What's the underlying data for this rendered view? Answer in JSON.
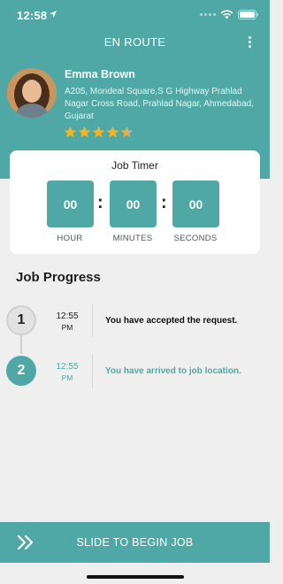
{
  "status_bar": {
    "time": "12:58"
  },
  "nav": {
    "title": "EN ROUTE"
  },
  "customer": {
    "name": "Emma Brown",
    "address": "A205, Mondeal Square,S G Highway Prahlad Nagar Cross Road, Prahlad Nagar, Ahmedabad, Gujarat",
    "rating": 4.5,
    "rating_max": 5
  },
  "timer": {
    "title": "Job Timer",
    "hour": "00",
    "minutes": "00",
    "seconds": "00",
    "hour_label": "HOUR",
    "minutes_label": "MINUTES",
    "seconds_label": "SECONDS"
  },
  "progress": {
    "title": "Job Progress",
    "steps": [
      {
        "number": "1",
        "time": "12:55",
        "ampm": "PM",
        "text": "You have accepted the request.",
        "state": "completed"
      },
      {
        "number": "2",
        "time": "12:55",
        "ampm": "PM",
        "text": "You have arrived to job location.",
        "state": "current"
      }
    ]
  },
  "slide": {
    "label": "SLIDE TO BEGIN JOB"
  },
  "colors": {
    "accent": "#4fa8a6",
    "background": "#efefef",
    "star": "#f0b429"
  }
}
